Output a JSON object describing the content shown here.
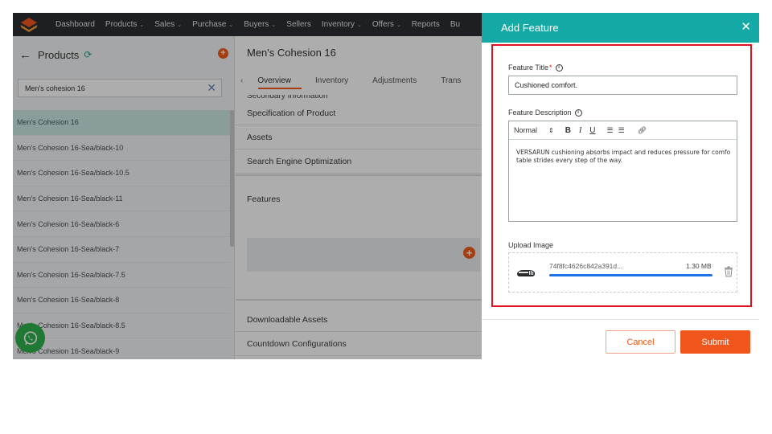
{
  "topnav": {
    "items": [
      {
        "label": "Dashboard",
        "caret": ""
      },
      {
        "label": "Products",
        "caret": "⌄"
      },
      {
        "label": "Sales",
        "caret": "⌄"
      },
      {
        "label": "Purchase",
        "caret": "⌄"
      },
      {
        "label": "Buyers",
        "caret": "⌄"
      },
      {
        "label": "Sellers",
        "caret": ""
      },
      {
        "label": "Inventory",
        "caret": "⌄"
      },
      {
        "label": "Offers",
        "caret": "⌄"
      },
      {
        "label": "Reports",
        "caret": ""
      },
      {
        "label": "Bu",
        "caret": ""
      }
    ]
  },
  "sidebar": {
    "title": "Products",
    "search_value": "Men's cohesion 16",
    "items": [
      "Men's Cohesion 16",
      "Men's Cohesion 16-Sea/black-10",
      "Men's Cohesion 16-Sea/black-10.5",
      "Men's Cohesion 16-Sea/black-11",
      "Men's Cohesion 16-Sea/black-6",
      "Men's Cohesion 16-Sea/black-7",
      "Men's Cohesion 16-Sea/black-7.5",
      "Men's Cohesion 16-Sea/black-8",
      "Men's Cohesion 16-Sea/black-8.5",
      "Men's Cohesion 16-Sea/black-9"
    ]
  },
  "main": {
    "title": "Men's Cohesion 16",
    "tabs": [
      "Overview",
      "Inventory",
      "Adjustments",
      "Trans"
    ],
    "partial_section": "Secondary Information",
    "sections": {
      "specification": "Specification of Product",
      "assets": "Assets",
      "seo": "Search Engine Optimization",
      "features": "Features",
      "downloadable": "Downloadable Assets",
      "countdown": "Countdown Configurations"
    }
  },
  "drawer": {
    "title": "Add Feature",
    "feature_title_label": "Feature Title",
    "required_mark": "*",
    "feature_title_value": "Cushioned comfort.",
    "feature_description_label": "Feature Description",
    "toolbar": {
      "format": "Normal",
      "bold": "B",
      "italic": "I",
      "underline": "U"
    },
    "description_text": "VERSARUN cushioning absorbs impact and reduces pressure for comfo table strides every step of the way.",
    "upload_label": "Upload Image",
    "upload": {
      "file_name": "74f8fc4626c842a391d...",
      "file_size": "1.30 MB",
      "progress": 1.0
    },
    "cancel_label": "Cancel",
    "submit_label": "Submit"
  },
  "colors": {
    "accent": "#f0561c",
    "header_teal": "#14a9a4",
    "highlight_red": "#e0121f",
    "progress_blue": "#1a73e8",
    "whatsapp_green": "#2fb24c"
  }
}
